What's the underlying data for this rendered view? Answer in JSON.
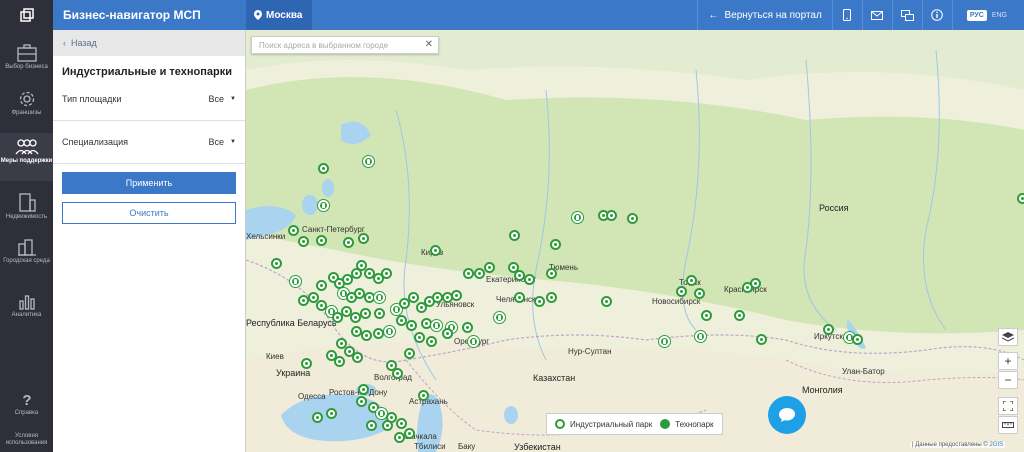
{
  "header": {
    "app_title": "Бизнес-навигатор МСП",
    "city": "Москва",
    "back_to_portal": "Вернуться на портал",
    "lang_ru": "РУС",
    "lang_en": "ENG",
    "icons": [
      "pin-icon",
      "arrow-left-icon",
      "phone-icon",
      "mail-icon",
      "chat-icon",
      "info-icon"
    ]
  },
  "nav": {
    "items": [
      {
        "label": "Выбор бизнеса",
        "icon": "briefcase-icon"
      },
      {
        "label": "Франшизы",
        "icon": "gear-icon"
      },
      {
        "label": "Меры поддержки",
        "icon": "people-icon",
        "active": true
      },
      {
        "label": "Недвижимость",
        "icon": "building-icon"
      },
      {
        "label": "Городская среда",
        "icon": "city-icon"
      },
      {
        "label": "Аналитика",
        "icon": "chart-icon"
      },
      {
        "label": "Справка",
        "icon": "question-icon"
      },
      {
        "label": "Условия использования",
        "icon": "none"
      }
    ]
  },
  "panel": {
    "back_label": "Назад",
    "title": "Индустриальные и технопарки",
    "filters": [
      {
        "label": "Тип площадки",
        "value": "Все"
      },
      {
        "label": "Специализация",
        "value": "Все"
      }
    ],
    "apply_label": "Применить",
    "clear_label": "Очистить"
  },
  "map": {
    "search_placeholder": "Поиск адреса в выбранном городе",
    "labels": {
      "russia": "Россия",
      "spb": "Санкт-Петербург",
      "helsinki": "Хельсинки",
      "belarus": "Республика Беларусь",
      "ukraine": "Украина",
      "kiev": "Киев",
      "odessa": "Одесса",
      "kazakhstan": "Казахстан",
      "nursultan": "Нур-Султан",
      "mongolia": "Монголия",
      "ulanbator": "Улан-Батор",
      "uzbekistan": "Узбекистан",
      "volgograd": "Волгоград",
      "astrakhan": "Астрахань",
      "rostov": "Ростов-на-Дону",
      "makhachkala": "Махачкала",
      "kirov": "Киров",
      "tyumen": "Тюмень",
      "chelyabinsk": "Челябинск",
      "orenburg": "Оренбург",
      "ekaterinburg": "Екатеринбург",
      "ulyanovsk": "Ульяновск",
      "novosibirsk": "Новосибирск",
      "tomsk": "Томск",
      "krasnoyarsk": "Красноярск",
      "irkutsk": "Иркутск",
      "tbilisi": "Тбилиси",
      "baku": "Баку"
    },
    "legend": {
      "industrial": "Индустриальный парк",
      "tech": "Технопарк"
    },
    "attribution": "| Данные предоставлены © ",
    "attribution_brand": "2GIS",
    "controls": [
      "layers-icon",
      "zoom-in-icon",
      "zoom-out-icon",
      "fullscreen-icon",
      "ruler-icon"
    ],
    "zoom_in": "+",
    "zoom_out": "−"
  }
}
